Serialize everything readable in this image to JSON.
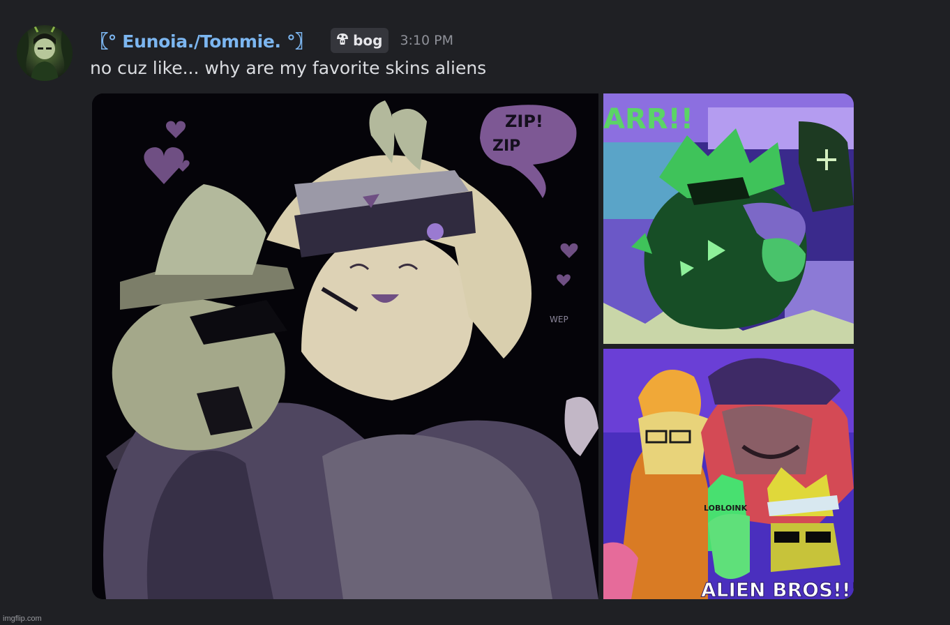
{
  "message": {
    "author": "〖° Eunoia./Tommie. °〗",
    "tag": {
      "icon": "mushroom-icon",
      "label": "bog"
    },
    "timestamp": "3:10 PM",
    "content": "no cuz like... why are my favorite skins aliens",
    "colors": {
      "background": "#1f2024",
      "username": "#7cb6f0",
      "tag_bg": "#35363c",
      "text": "#dbdde1",
      "timestamp": "#8f9199"
    },
    "attachments": {
      "first": {
        "speech_bubble_line1": "ZIP!",
        "speech_bubble_line2": "ZIP",
        "signature": "WEP"
      },
      "second": {
        "banner_text": "ARR!!"
      },
      "third": {
        "cap_text": "LOBLOINK",
        "bottom_text": "ALIEN BROS!!!"
      }
    }
  },
  "watermark": "imgflip.com"
}
